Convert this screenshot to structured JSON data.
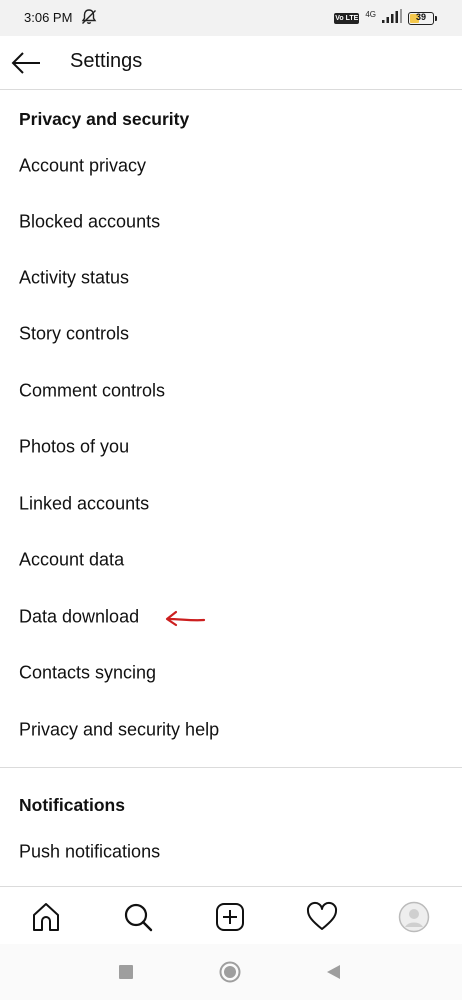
{
  "status_bar": {
    "time": "3:06 PM",
    "network": "4G",
    "volte": "Vo LTE",
    "battery": "39",
    "battery_level": 0.39
  },
  "header": {
    "title": "Settings"
  },
  "sections": [
    {
      "title": "Privacy and security",
      "items": [
        {
          "label": "Account privacy"
        },
        {
          "label": "Blocked accounts"
        },
        {
          "label": "Activity status"
        },
        {
          "label": "Story controls"
        },
        {
          "label": "Comment controls"
        },
        {
          "label": "Photos of you"
        },
        {
          "label": "Linked accounts"
        },
        {
          "label": "Account data"
        },
        {
          "label": "Data download"
        },
        {
          "label": "Contacts syncing"
        },
        {
          "label": "Privacy and security help"
        }
      ]
    },
    {
      "title": "Notifications",
      "items": [
        {
          "label": "Push notifications"
        }
      ]
    }
  ],
  "annotation": {
    "icon": "red-arrow-icon",
    "color": "#cc1f1f"
  },
  "bottom_nav": {
    "icons": [
      "home-icon",
      "search-icon",
      "add-post-icon",
      "activity-heart-icon",
      "profile-avatar-icon"
    ]
  },
  "system_nav": {
    "icons": [
      "recent-apps-icon",
      "home-circle-icon",
      "back-triangle-icon"
    ]
  }
}
